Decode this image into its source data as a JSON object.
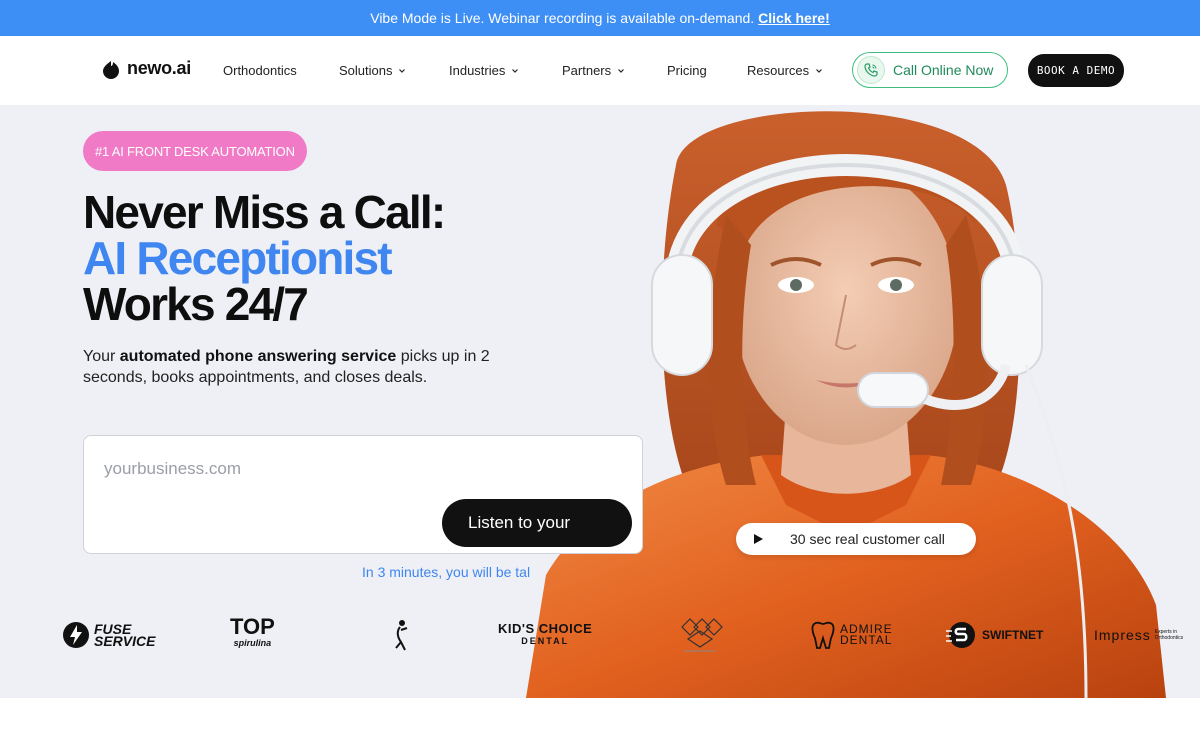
{
  "announcement": {
    "text": "Vibe Mode is Live. Webinar recording is available on-demand.",
    "link": "Click here!"
  },
  "header": {
    "logo_text": "newo.ai",
    "nav": [
      {
        "label": "Orthodontics",
        "has_dropdown": false
      },
      {
        "label": "Solutions",
        "has_dropdown": true
      },
      {
        "label": "Industries",
        "has_dropdown": true
      },
      {
        "label": "Partners",
        "has_dropdown": true
      },
      {
        "label": "Pricing",
        "has_dropdown": false
      },
      {
        "label": "Resources",
        "has_dropdown": true
      }
    ],
    "call_button": "Call Online Now",
    "demo_button": "BOOK A DEMO"
  },
  "hero": {
    "badge": "#1 AI FRONT DESK AUTOMATION",
    "headline_line1": "Never Miss a Call:",
    "headline_line2": "AI Receptionist",
    "headline_line3": "Works 24/7",
    "sub_prefix": "Your ",
    "sub_bold": "automated phone answering service",
    "sub_suffix": " picks up in 2 seconds, books appointments, and closes deals.",
    "input_placeholder": "yourbusiness.com",
    "listen_button": "Listen to your",
    "note": "In 3 minutes, you will be tal",
    "play_label": "30 sec real customer call"
  },
  "logos": [
    {
      "top": "FUSE",
      "bottom": "SERVICE"
    },
    {
      "top": "TOP",
      "bottom": "spirulina"
    },
    {
      "top": "KID'S CHOICE",
      "bottom": "DENTAL"
    },
    {
      "top": "ADMIRE",
      "bottom": "DENTAL"
    },
    {
      "top": "SWIFTNET",
      "bottom": ""
    },
    {
      "top": "Impress",
      "bottom": "Experts in Orthodontics"
    }
  ],
  "colors": {
    "announce_bg": "#3d8ef5",
    "accent_blue": "#3f86f0",
    "badge_pink": "#f07ac6",
    "call_green": "#3fbf7f",
    "hero_bg": "#eef0f5",
    "suit_orange": "#e8652a"
  }
}
